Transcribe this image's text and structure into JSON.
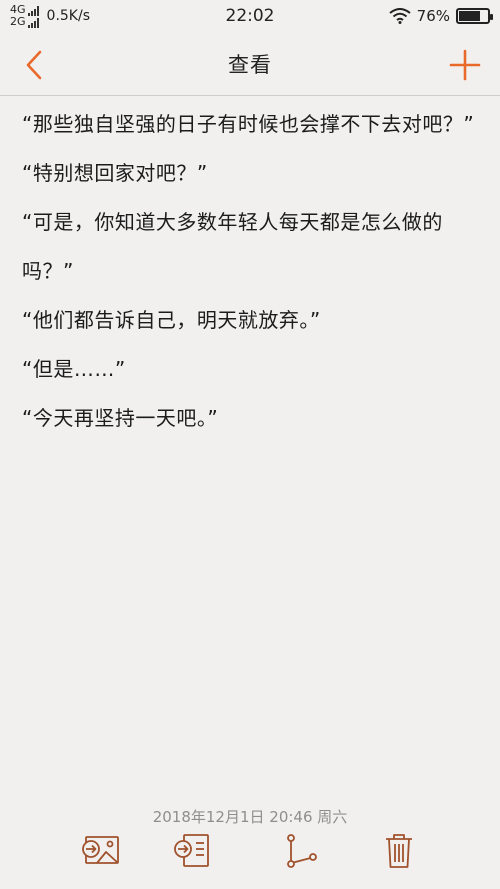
{
  "status_bar": {
    "net_top": "4G",
    "net_bottom": "2G",
    "speed": "0.5K/s",
    "time": "22:02",
    "battery_text": "76%",
    "battery_level": 0.76
  },
  "header": {
    "title": "查看",
    "back_icon": "chevron-left-icon",
    "add_icon": "plus-icon",
    "accent_color": "#e8692a"
  },
  "note": {
    "paragraphs": [
      "“那些独自坚强的日子有时候也会撑不下去对吧？” “特别想回家对吧？”",
      "“可是，你知道大多数年轻人每天都是怎么做的吗？”",
      "“他们都告诉自己，明天就放弃。”",
      "“但是……”",
      "“今天再坚持一天吧。”"
    ]
  },
  "footer": {
    "timestamp": "2018年12月1日 20:46 周六",
    "tools": [
      "export-image-icon",
      "export-text-icon",
      "share-icon",
      "trash-icon"
    ],
    "icon_color": "#a0522d"
  }
}
